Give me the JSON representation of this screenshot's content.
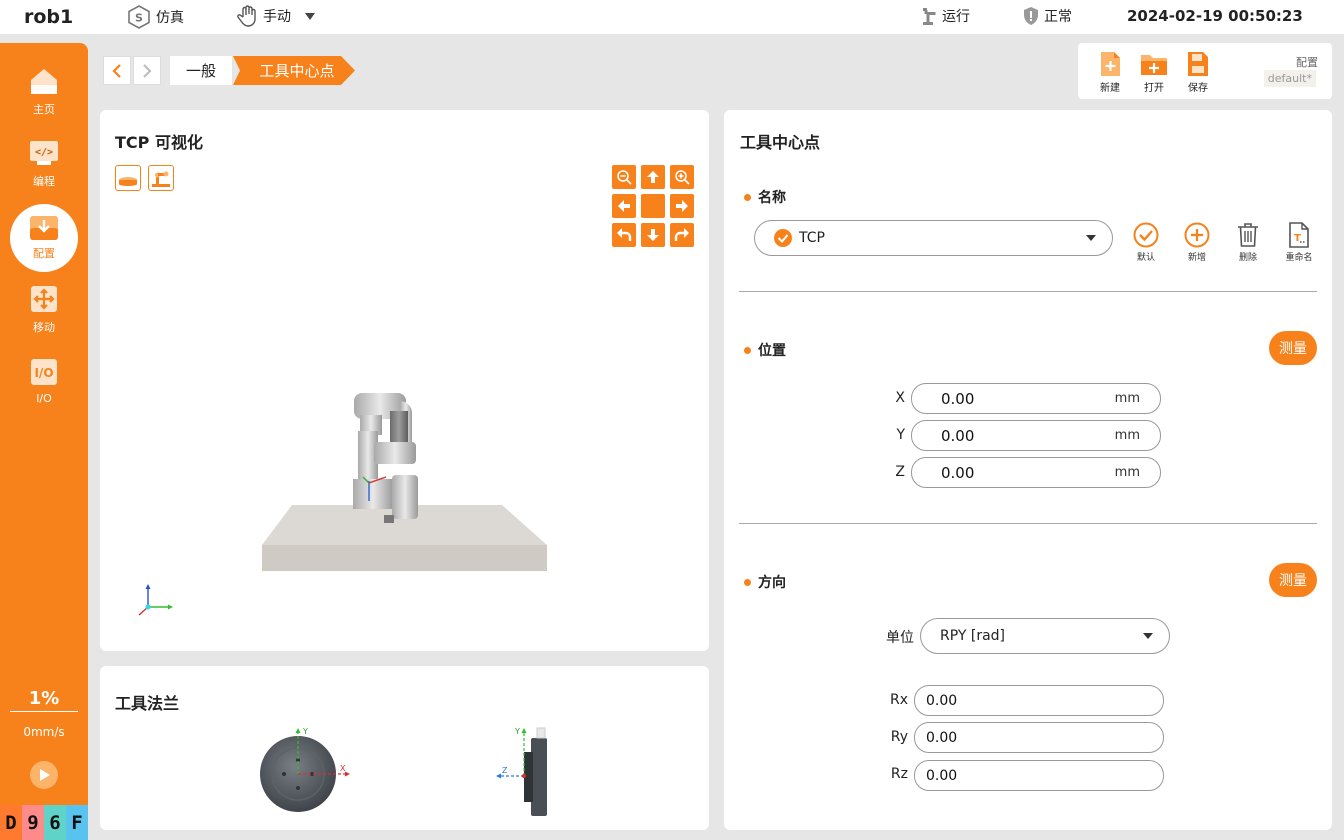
{
  "header": {
    "robot_name": "rob1",
    "sim_label": "仿真",
    "mode_label": "手动",
    "run_label": "运行",
    "state_label": "正常",
    "datetime": "2024-02-19 00:50:23"
  },
  "sidebar": {
    "items": [
      {
        "label": "主页",
        "icon": "home-icon"
      },
      {
        "label": "编程",
        "icon": "code-icon"
      },
      {
        "label": "配置",
        "icon": "config-icon"
      },
      {
        "label": "移动",
        "icon": "move-icon"
      },
      {
        "label": "I/O",
        "icon": "io-icon"
      }
    ],
    "active_index": 2,
    "speed_percent": "1%",
    "speed_mm": "0mm/s",
    "badges": [
      {
        "text": "D",
        "color": "#ff7a2f"
      },
      {
        "text": "9",
        "color": "#ff8a8a"
      },
      {
        "text": "6",
        "color": "#5fd3c8"
      },
      {
        "text": "F",
        "color": "#59c3f0"
      }
    ]
  },
  "breadcrumb": {
    "items": [
      "一般",
      "工具中心点"
    ]
  },
  "config": {
    "new_label": "新建",
    "open_label": "打开",
    "save_label": "保存",
    "title": "配置",
    "value": "default*"
  },
  "tcp_viz": {
    "title": "TCP 可视化"
  },
  "flange": {
    "title": "工具法兰",
    "front_axes": {
      "y": "Y",
      "x": "X"
    },
    "side_axes": {
      "y": "Y",
      "z": "Z"
    }
  },
  "tcp_panel": {
    "title": "工具中心点",
    "name_section": "名称",
    "selected_tcp": "TCP",
    "actions": {
      "default": "默认",
      "new": "新增",
      "delete": "删除",
      "rename": "重命名"
    },
    "position_section": "位置",
    "measure_label": "测量",
    "position": [
      {
        "axis": "X",
        "value": "0.00",
        "unit": "mm"
      },
      {
        "axis": "Y",
        "value": "0.00",
        "unit": "mm"
      },
      {
        "axis": "Z",
        "value": "0.00",
        "unit": "mm"
      }
    ],
    "orientation_section": "方向",
    "unit_label": "单位",
    "unit_value": "RPY [rad]",
    "orientation": [
      {
        "axis": "Rx",
        "value": "0.00"
      },
      {
        "axis": "Ry",
        "value": "0.00"
      },
      {
        "axis": "Rz",
        "value": "0.00"
      }
    ]
  },
  "colors": {
    "accent": "#f7821b",
    "background": "#e6e6e6"
  }
}
